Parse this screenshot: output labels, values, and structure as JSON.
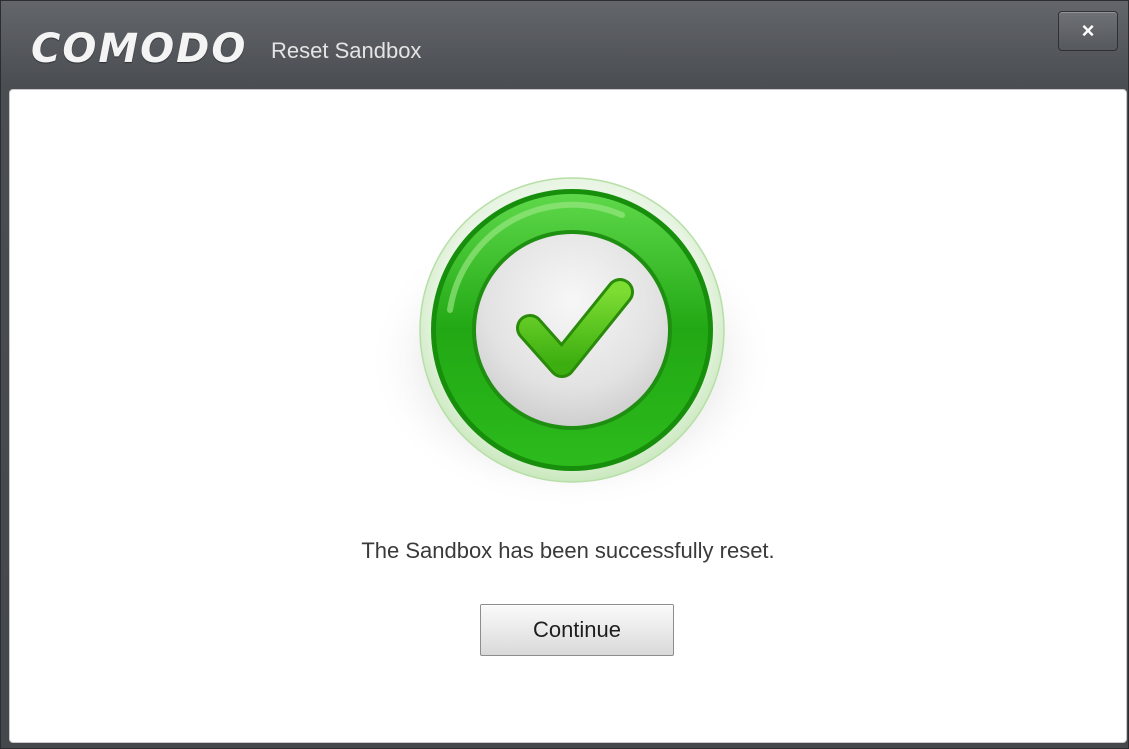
{
  "window": {
    "brand": "COMODO",
    "title": "Reset Sandbox",
    "close_label": "×"
  },
  "main": {
    "status_icon": "success-checkmark-icon",
    "message": "The Sandbox has been successfully reset.",
    "continue_label": "Continue"
  },
  "colors": {
    "title_bar": "#55585d",
    "ring_green": "#2fb81f",
    "check_green": "#57c81e",
    "content_bg": "#ffffff"
  }
}
